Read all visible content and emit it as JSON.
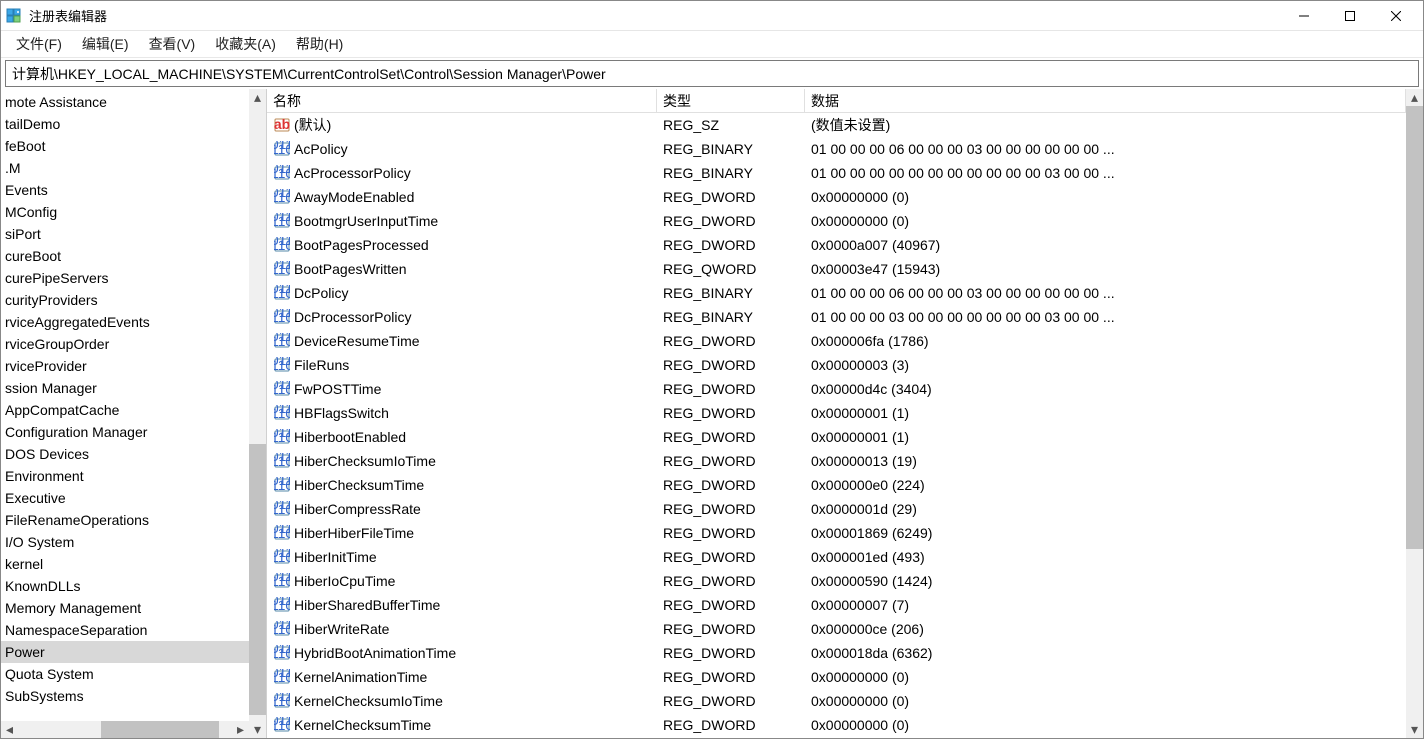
{
  "title": "注册表编辑器",
  "menu": {
    "file": "文件(F)",
    "edit": "编辑(E)",
    "view": "查看(V)",
    "fav": "收藏夹(A)",
    "help": "帮助(H)"
  },
  "address": "计算机\\HKEY_LOCAL_MACHINE\\SYSTEM\\CurrentControlSet\\Control\\Session Manager\\Power",
  "columns": {
    "name": "名称",
    "type": "类型",
    "data": "数据"
  },
  "tree": [
    {
      "label": "mote Assistance"
    },
    {
      "label": "tailDemo"
    },
    {
      "label": "feBoot"
    },
    {
      "label": ".M"
    },
    {
      "label": "Events"
    },
    {
      "label": "MConfig"
    },
    {
      "label": "siPort"
    },
    {
      "label": "cureBoot"
    },
    {
      "label": "curePipeServers"
    },
    {
      "label": "curityProviders"
    },
    {
      "label": "rviceAggregatedEvents"
    },
    {
      "label": "rviceGroupOrder"
    },
    {
      "label": "rviceProvider"
    },
    {
      "label": "ssion Manager"
    },
    {
      "label": "AppCompatCache"
    },
    {
      "label": "Configuration Manager"
    },
    {
      "label": "DOS Devices"
    },
    {
      "label": "Environment"
    },
    {
      "label": "Executive"
    },
    {
      "label": "FileRenameOperations"
    },
    {
      "label": "I/O System"
    },
    {
      "label": "kernel"
    },
    {
      "label": "KnownDLLs"
    },
    {
      "label": "Memory Management"
    },
    {
      "label": "NamespaceSeparation"
    },
    {
      "label": "Power",
      "selected": true
    },
    {
      "label": "Quota System"
    },
    {
      "label": "SubSystems"
    }
  ],
  "values": [
    {
      "icon": "sz",
      "name": "(默认)",
      "type": "REG_SZ",
      "data": "(数值未设置)"
    },
    {
      "icon": "bin",
      "name": "AcPolicy",
      "type": "REG_BINARY",
      "data": "01 00 00 00 06 00 00 00 03 00 00 00 00 00 00 ..."
    },
    {
      "icon": "bin",
      "name": "AcProcessorPolicy",
      "type": "REG_BINARY",
      "data": "01 00 00 00 00 00 00 00 00 00 00 00 03 00 00 ..."
    },
    {
      "icon": "bin",
      "name": "AwayModeEnabled",
      "type": "REG_DWORD",
      "data": "0x00000000 (0)"
    },
    {
      "icon": "bin",
      "name": "BootmgrUserInputTime",
      "type": "REG_DWORD",
      "data": "0x00000000 (0)"
    },
    {
      "icon": "bin",
      "name": "BootPagesProcessed",
      "type": "REG_DWORD",
      "data": "0x0000a007 (40967)"
    },
    {
      "icon": "bin",
      "name": "BootPagesWritten",
      "type": "REG_QWORD",
      "data": "0x00003e47 (15943)"
    },
    {
      "icon": "bin",
      "name": "DcPolicy",
      "type": "REG_BINARY",
      "data": "01 00 00 00 06 00 00 00 03 00 00 00 00 00 00 ..."
    },
    {
      "icon": "bin",
      "name": "DcProcessorPolicy",
      "type": "REG_BINARY",
      "data": "01 00 00 00 03 00 00 00 00 00 00 00 03 00 00 ..."
    },
    {
      "icon": "bin",
      "name": "DeviceResumeTime",
      "type": "REG_DWORD",
      "data": "0x000006fa (1786)"
    },
    {
      "icon": "bin",
      "name": "FileRuns",
      "type": "REG_DWORD",
      "data": "0x00000003 (3)"
    },
    {
      "icon": "bin",
      "name": "FwPOSTTime",
      "type": "REG_DWORD",
      "data": "0x00000d4c (3404)"
    },
    {
      "icon": "bin",
      "name": "HBFlagsSwitch",
      "type": "REG_DWORD",
      "data": "0x00000001 (1)"
    },
    {
      "icon": "bin",
      "name": "HiberbootEnabled",
      "type": "REG_DWORD",
      "data": "0x00000001 (1)"
    },
    {
      "icon": "bin",
      "name": "HiberChecksumIoTime",
      "type": "REG_DWORD",
      "data": "0x00000013 (19)"
    },
    {
      "icon": "bin",
      "name": "HiberChecksumTime",
      "type": "REG_DWORD",
      "data": "0x000000e0 (224)"
    },
    {
      "icon": "bin",
      "name": "HiberCompressRate",
      "type": "REG_DWORD",
      "data": "0x0000001d (29)"
    },
    {
      "icon": "bin",
      "name": "HiberHiberFileTime",
      "type": "REG_DWORD",
      "data": "0x00001869 (6249)"
    },
    {
      "icon": "bin",
      "name": "HiberInitTime",
      "type": "REG_DWORD",
      "data": "0x000001ed (493)"
    },
    {
      "icon": "bin",
      "name": "HiberIoCpuTime",
      "type": "REG_DWORD",
      "data": "0x00000590 (1424)"
    },
    {
      "icon": "bin",
      "name": "HiberSharedBufferTime",
      "type": "REG_DWORD",
      "data": "0x00000007 (7)"
    },
    {
      "icon": "bin",
      "name": "HiberWriteRate",
      "type": "REG_DWORD",
      "data": "0x000000ce (206)"
    },
    {
      "icon": "bin",
      "name": "HybridBootAnimationTime",
      "type": "REG_DWORD",
      "data": "0x000018da (6362)"
    },
    {
      "icon": "bin",
      "name": "KernelAnimationTime",
      "type": "REG_DWORD",
      "data": "0x00000000 (0)"
    },
    {
      "icon": "bin",
      "name": "KernelChecksumIoTime",
      "type": "REG_DWORD",
      "data": "0x00000000 (0)"
    },
    {
      "icon": "bin",
      "name": "KernelChecksumTime",
      "type": "REG_DWORD",
      "data": "0x00000000 (0)"
    }
  ]
}
